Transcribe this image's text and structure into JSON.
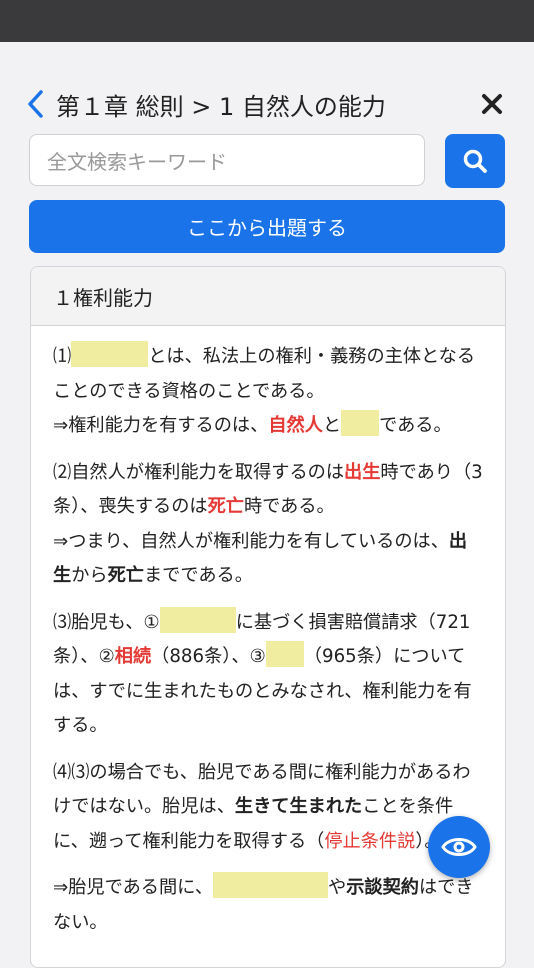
{
  "header": {
    "title": "第１章 総則 > 1 自然人の能力"
  },
  "search": {
    "placeholder": "全文検索キーワード"
  },
  "start_button": "ここから出題する",
  "section": {
    "title": "１権利能力",
    "p1": {
      "n": "⑴",
      "t1": "とは、私法上の権利・義務の主体となることのできる資格のことである。",
      "l2a": "⇒権利能力を有するのは、",
      "red1": "自然人",
      "and": "と",
      "l2b": "である。"
    },
    "p2": {
      "a": "⑵自然人が権利能力を取得するのは",
      "red1": "出生",
      "b": "時であり（3条）、喪失するのは",
      "red2": "死亡",
      "c": "時である。",
      "d": "⇒つまり、自然人が権利能力を有しているのは、",
      "bold1": "出生",
      "e": "から",
      "bold2": "死亡",
      "f": "までである。"
    },
    "p3": {
      "a": "⑶胎児も、①",
      "b": "に基づく損害賠償請求（721条）、②",
      "red1": "相続",
      "c": "（886条）、③",
      "d": "（965条）については、すでに生まれたものとみなされ、権利能力を有する。"
    },
    "p4": {
      "a": "⑷⑶の場合でも、胎児である間に権利能力があるわけではない。胎児は、",
      "bold1": "生きて生まれた",
      "b": "ことを条件に、遡って権利能力を取得する（",
      "red1": "停止条件説",
      "c": "）。"
    },
    "p5": {
      "a": "⇒胎児である間に、",
      "b": "や",
      "bold1": "示談契約",
      "c": "はできない。"
    }
  },
  "icons": {
    "back": "chevron-left-icon",
    "close": "close-icon",
    "search": "search-icon",
    "eye": "eye-icon"
  },
  "colors": {
    "accent": "#1a73e8",
    "emphasis": "#e53935",
    "highlight": "#f0eda0"
  }
}
